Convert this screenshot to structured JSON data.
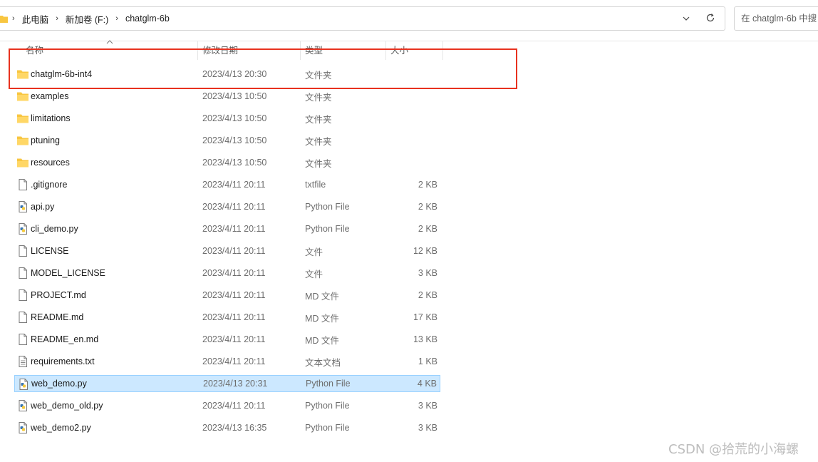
{
  "breadcrumb": [
    "此电脑",
    "新加卷 (F:)",
    "chatglm-6b"
  ],
  "search": {
    "placeholder": "在 chatglm-6b 中搜"
  },
  "columns": {
    "name": "名称",
    "date": "修改日期",
    "type": "类型",
    "size": "大小"
  },
  "files": [
    {
      "name": "chatglm-6b-int4",
      "date": "2023/4/13 20:30",
      "type": "文件夹",
      "size": "",
      "icon": "folder-icon"
    },
    {
      "name": "examples",
      "date": "2023/4/13 10:50",
      "type": "文件夹",
      "size": "",
      "icon": "folder-icon"
    },
    {
      "name": "limitations",
      "date": "2023/4/13 10:50",
      "type": "文件夹",
      "size": "",
      "icon": "folder-icon"
    },
    {
      "name": "ptuning",
      "date": "2023/4/13 10:50",
      "type": "文件夹",
      "size": "",
      "icon": "folder-icon"
    },
    {
      "name": "resources",
      "date": "2023/4/13 10:50",
      "type": "文件夹",
      "size": "",
      "icon": "folder-icon"
    },
    {
      "name": ".gitignore",
      "date": "2023/4/11 20:11",
      "type": "txtfile",
      "size": "2 KB",
      "icon": "file-icon"
    },
    {
      "name": "api.py",
      "date": "2023/4/11 20:11",
      "type": "Python File",
      "size": "2 KB",
      "icon": "python-file-icon"
    },
    {
      "name": "cli_demo.py",
      "date": "2023/4/11 20:11",
      "type": "Python File",
      "size": "2 KB",
      "icon": "python-file-icon"
    },
    {
      "name": "LICENSE",
      "date": "2023/4/11 20:11",
      "type": "文件",
      "size": "12 KB",
      "icon": "file-icon"
    },
    {
      "name": "MODEL_LICENSE",
      "date": "2023/4/11 20:11",
      "type": "文件",
      "size": "3 KB",
      "icon": "file-icon"
    },
    {
      "name": "PROJECT.md",
      "date": "2023/4/11 20:11",
      "type": "MD 文件",
      "size": "2 KB",
      "icon": "file-icon"
    },
    {
      "name": "README.md",
      "date": "2023/4/11 20:11",
      "type": "MD 文件",
      "size": "17 KB",
      "icon": "file-icon"
    },
    {
      "name": "README_en.md",
      "date": "2023/4/11 20:11",
      "type": "MD 文件",
      "size": "13 KB",
      "icon": "file-icon"
    },
    {
      "name": "requirements.txt",
      "date": "2023/4/11 20:11",
      "type": "文本文档",
      "size": "1 KB",
      "icon": "text-file-icon"
    },
    {
      "name": "web_demo.py",
      "date": "2023/4/13 20:31",
      "type": "Python File",
      "size": "4 KB",
      "icon": "python-file-icon",
      "selected": true
    },
    {
      "name": "web_demo_old.py",
      "date": "2023/4/11 20:11",
      "type": "Python File",
      "size": "3 KB",
      "icon": "python-file-icon"
    },
    {
      "name": "web_demo2.py",
      "date": "2023/4/13 16:35",
      "type": "Python File",
      "size": "3 KB",
      "icon": "python-file-icon"
    }
  ],
  "watermark": "CSDN @拾荒的小海螺",
  "colors": {
    "selection": "#cce8ff",
    "selection_border": "#99d1ff",
    "highlight": "#e8321f",
    "folder": "#f8c640"
  }
}
